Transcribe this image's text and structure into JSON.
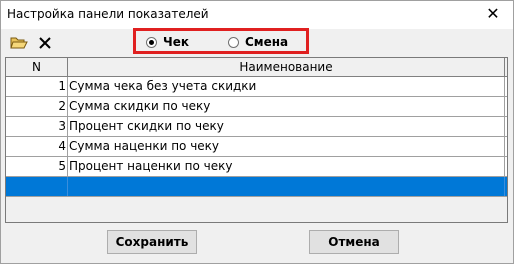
{
  "window": {
    "title": "Настройка панели показателей",
    "close_glyph": "✕"
  },
  "toolbar": {
    "open_icon": "folder-open-icon",
    "delete_icon": "delete-x-icon"
  },
  "mode": {
    "options": [
      {
        "label": "Чек",
        "selected": true
      },
      {
        "label": "Смена",
        "selected": false
      }
    ],
    "highlight_color": "#e02020"
  },
  "grid": {
    "columns": [
      "N",
      "Наименование"
    ],
    "rows": [
      {
        "n": "1",
        "name": "Сумма чека без учета скидки"
      },
      {
        "n": "2",
        "name": "Сумма скидки по чеку"
      },
      {
        "n": "3",
        "name": "Процент скидки по чеку"
      },
      {
        "n": "4",
        "name": "Сумма наценки по чеку"
      },
      {
        "n": "5",
        "name": "Процент наценки по чеку"
      },
      {
        "n": "",
        "name": ""
      }
    ],
    "selected_row_index": 5,
    "selection_color": "#0078d7"
  },
  "buttons": {
    "save": "Сохранить",
    "cancel": "Отмена"
  }
}
